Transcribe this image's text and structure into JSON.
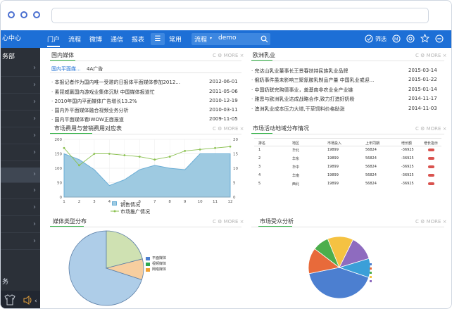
{
  "sidebar": {
    "title": "心中心",
    "category": "务部",
    "footer_label": "务"
  },
  "topnav": {
    "items": [
      "门户",
      "流程",
      "微博",
      "通信",
      "报表"
    ],
    "common": "常用",
    "dropdown": "流程",
    "search_value": "demo",
    "filter_label": "筛选"
  },
  "panel_tools": "C ⚙ MORE ×",
  "news": {
    "title": "国内媒体",
    "tabs": [
      "国内平面媒...",
      "4A广告"
    ],
    "items": [
      {
        "text": "本报记者作为国内唯一受邀的日报体平面媒体参加2012...",
        "date": "2012-06-01"
      },
      {
        "text": "素琵威赢国内游戏业集体沉默 中国媒体报道忙",
        "date": "2011-05-06"
      },
      {
        "text": "2010年国内平面媒体广告增长13.2%",
        "date": "2010-12-19"
      },
      {
        "text": "国内外平面媒体融合视频业务分析",
        "date": "2010-03-11"
      },
      {
        "text": "国内平面媒体看IWOW正面报道",
        "date": "2009-11-05"
      }
    ]
  },
  "milk": {
    "title": "欧洲乳业",
    "items": [
      {
        "text": "完达山乳业董事长王景春扶持民族乳业品牌",
        "date": "2015-03-14"
      },
      {
        "text": "俄奶事件虽未影响三聚氰胺乳制品产量 中国乳业或迎...",
        "date": "2015-01-22"
      },
      {
        "text": "中国奶联完购德事业，奠基南非农业全产业链",
        "date": "2015-01-14"
      },
      {
        "text": "雅恩与欧洲乳业达成战略合作,致力打造好奶粉",
        "date": "2014-11-17"
      },
      {
        "text": "澳洲乳业成本压力大增,干草饲料价格助涨",
        "date": "2014-11-03"
      }
    ]
  },
  "cost_chart": {
    "title": "市场费用与营销费用对应表",
    "legend": [
      "销售情况",
      "市场推广情况"
    ],
    "colors": {
      "area": "#9ecae1",
      "area_line": "#6baed6",
      "line": "#8cc152"
    }
  },
  "activity": {
    "title": "市场活动地域分布情况",
    "headers": [
      "排名",
      "地区",
      "市场投入",
      "上年同期",
      "增长额",
      "增长指示"
    ],
    "rows": [
      [
        "1",
        "华北",
        "19899",
        "56824",
        "-36925"
      ],
      [
        "2",
        "华东",
        "19899",
        "56824",
        "-36925"
      ],
      [
        "3",
        "华中",
        "19899",
        "56824",
        "-36925"
      ],
      [
        "4",
        "华南",
        "19899",
        "56824",
        "-36925"
      ],
      [
        "5",
        "西北",
        "19899",
        "56824",
        "-36925"
      ]
    ]
  },
  "media_chart": {
    "title": "媒体类型分布",
    "legend": [
      "平面媒体",
      "视频媒体",
      "网络媒体"
    ]
  },
  "audience_chart": {
    "title": "市场受众分析",
    "slice_label": "41.6%"
  },
  "chart_data": [
    {
      "type": "area",
      "title": "市场费用与营销费用对应表",
      "x": [
        1,
        2,
        3,
        4,
        5,
        6,
        7,
        8,
        9,
        10,
        11,
        12
      ],
      "ylim_left": [
        0,
        200
      ],
      "ylim_right": [
        0,
        20
      ],
      "series": [
        {
          "name": "销售情况",
          "type": "area",
          "axis": "left",
          "values": [
            150,
            130,
            95,
            40,
            60,
            95,
            110,
            100,
            95,
            150,
            150,
            150
          ]
        },
        {
          "name": "市场推广情况",
          "type": "line",
          "axis": "right",
          "values": [
            17,
            11,
            15,
            15,
            14.5,
            14,
            13,
            14,
            16,
            16.5,
            17,
            17.5
          ]
        }
      ],
      "grid": true,
      "legend_position": "bottom"
    },
    {
      "type": "pie",
      "title": "媒体类型分布",
      "categories": [
        "平面媒体",
        "视频媒体",
        "网络媒体"
      ],
      "values": [
        70,
        21,
        9
      ],
      "colors": [
        "#aecde8",
        "#cfe1b2",
        "#f7ce9f"
      ]
    },
    {
      "type": "pie",
      "title": "市场受众分析",
      "values": [
        41.6,
        13.5,
        8.5,
        13.5,
        13,
        9.9
      ],
      "colors": [
        "#4c7fd0",
        "#e86a3a",
        "#4cae4c",
        "#f5c242",
        "#8e6bbf",
        "#3b9fd8"
      ]
    }
  ]
}
